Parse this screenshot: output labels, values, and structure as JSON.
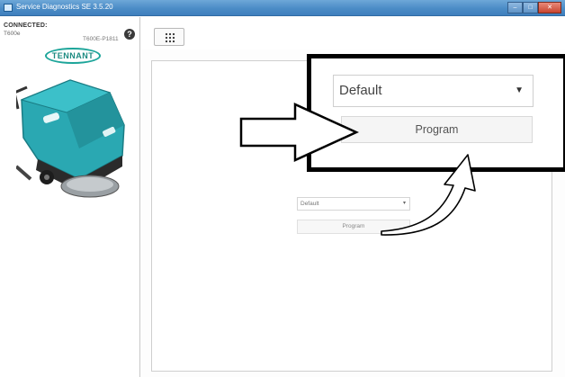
{
  "window": {
    "title": "Service Diagnostics SE 3.5.20",
    "controls": {
      "minimize": "–",
      "maximize": "□",
      "close": "✕"
    }
  },
  "sidebar": {
    "connection_label": "CONNECTED:",
    "model": "T600e",
    "serial": "T600E-P1811",
    "help_icon": "?",
    "logo_text": "TENNANT"
  },
  "toolbar": {
    "menu_icon": "grid-icon"
  },
  "main": {
    "select_value": "Default",
    "program_label": "Program"
  },
  "callout": {
    "select_value": "Default",
    "program_label": "Program"
  },
  "colors": {
    "titlebar": "#4b8cc6",
    "machine_body": "#2aa8b2",
    "brand_teal": "#1da59a",
    "callout_border": "#000000"
  }
}
